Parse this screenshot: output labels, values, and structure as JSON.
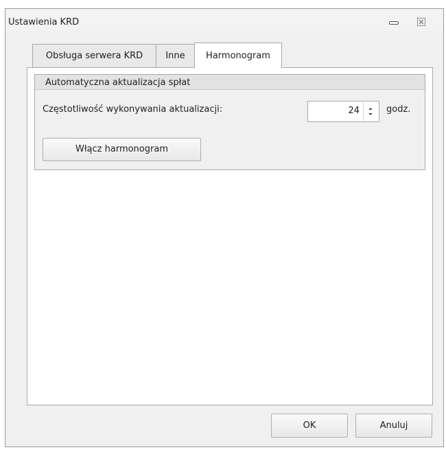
{
  "window": {
    "title": "Ustawienia KRD"
  },
  "tabs": [
    {
      "label": "Obsługa serwera KRD"
    },
    {
      "label": "Inne"
    },
    {
      "label": "Harmonogram"
    }
  ],
  "group": {
    "title": "Automatyczna aktualizacja spłat",
    "frequency_label": "Częstotliwość wykonywania aktualizacji:",
    "frequency_value": "24",
    "unit": "godz.",
    "schedule_button": "Włącz harmonogram"
  },
  "footer": {
    "ok_label": "OK",
    "cancel_label": "Anuluj"
  },
  "icons": {
    "minimize": "minimize-icon",
    "close": "close-icon"
  }
}
